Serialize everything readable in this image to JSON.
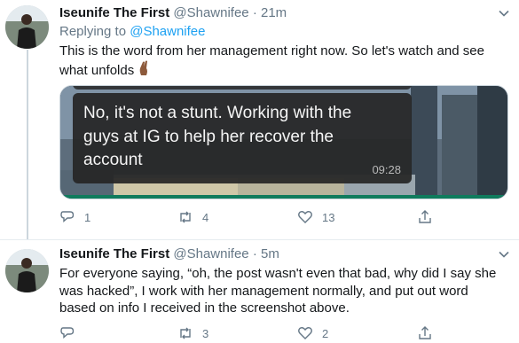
{
  "tweets": [
    {
      "author_name": "Iseunife The First",
      "handle": "@Shawnifee",
      "separator": "·",
      "time": "21m",
      "replying_label": "Replying to",
      "replying_handle": "@Shawnifee",
      "text": "This is the word from her management right now. So let's watch and see what unfolds",
      "emoji": "crossed-fingers-medium-dark",
      "media": {
        "message": "No, it's not a stunt. Working with the guys at IG to help her recover the account",
        "timestamp": "09:28"
      },
      "actions": {
        "replies": "1",
        "retweets": "4",
        "likes": "13"
      }
    },
    {
      "author_name": "Iseunife The First",
      "handle": "@Shawnifee",
      "separator": "·",
      "time": "5m",
      "text": "For everyone saying, “oh, the post wasn't even that bad, why did I say she was hacked”, I work with her management normally, and put out word based on info I received in the screenshot above.",
      "actions": {
        "replies": "",
        "retweets": "3",
        "likes": "2"
      }
    }
  ],
  "colors": {
    "accent": "#1da1f2",
    "muted": "#657786",
    "text": "#14171a",
    "chat_bubble": "#262626",
    "chat_green": "#0f7b5d"
  },
  "icons": [
    "avatar",
    "chevron-down-icon",
    "crossed-fingers-emoji",
    "reply-icon",
    "retweet-icon",
    "like-icon",
    "share-icon"
  ]
}
